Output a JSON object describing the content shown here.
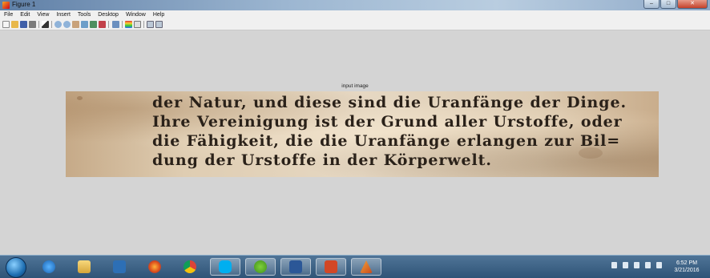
{
  "window": {
    "title": "Figure 1"
  },
  "menu": [
    "File",
    "Edit",
    "View",
    "Insert",
    "Tools",
    "Desktop",
    "Window",
    "Help"
  ],
  "toolbar": {
    "icons": [
      "new-figure-icon",
      "open-file-icon",
      "save-icon",
      "print-icon",
      "edit-plot-icon",
      "zoom-in-icon",
      "zoom-out-icon",
      "pan-icon",
      "rotate-3d-icon",
      "data-cursor-icon",
      "brush-icon",
      "link-plot-icon",
      "insert-colorbar-icon",
      "insert-legend-icon",
      "hide-plot-tools-icon",
      "show-plot-tools-icon"
    ]
  },
  "figure": {
    "title": "input image",
    "text_lines": [
      "der Natur, und diese sind die Uranfänge der Dinge.",
      "Ihre Vereinigung ist der Grund aller Urstoffe, oder",
      "die Fähigkeit, die die Uranfänge erlangen zur Bil=",
      "dung der Urstoffe in der Körperwelt."
    ]
  },
  "taskbar": {
    "apps": [
      "internet-explorer-icon",
      "file-explorer-icon",
      "media-player-icon",
      "firefox-icon",
      "chrome-icon",
      "skype-icon",
      "utorrent-icon",
      "word-icon",
      "powerpoint-icon",
      "matlab-icon"
    ],
    "clock": {
      "time": "6:52 PM",
      "date": "3/21/2016"
    }
  }
}
